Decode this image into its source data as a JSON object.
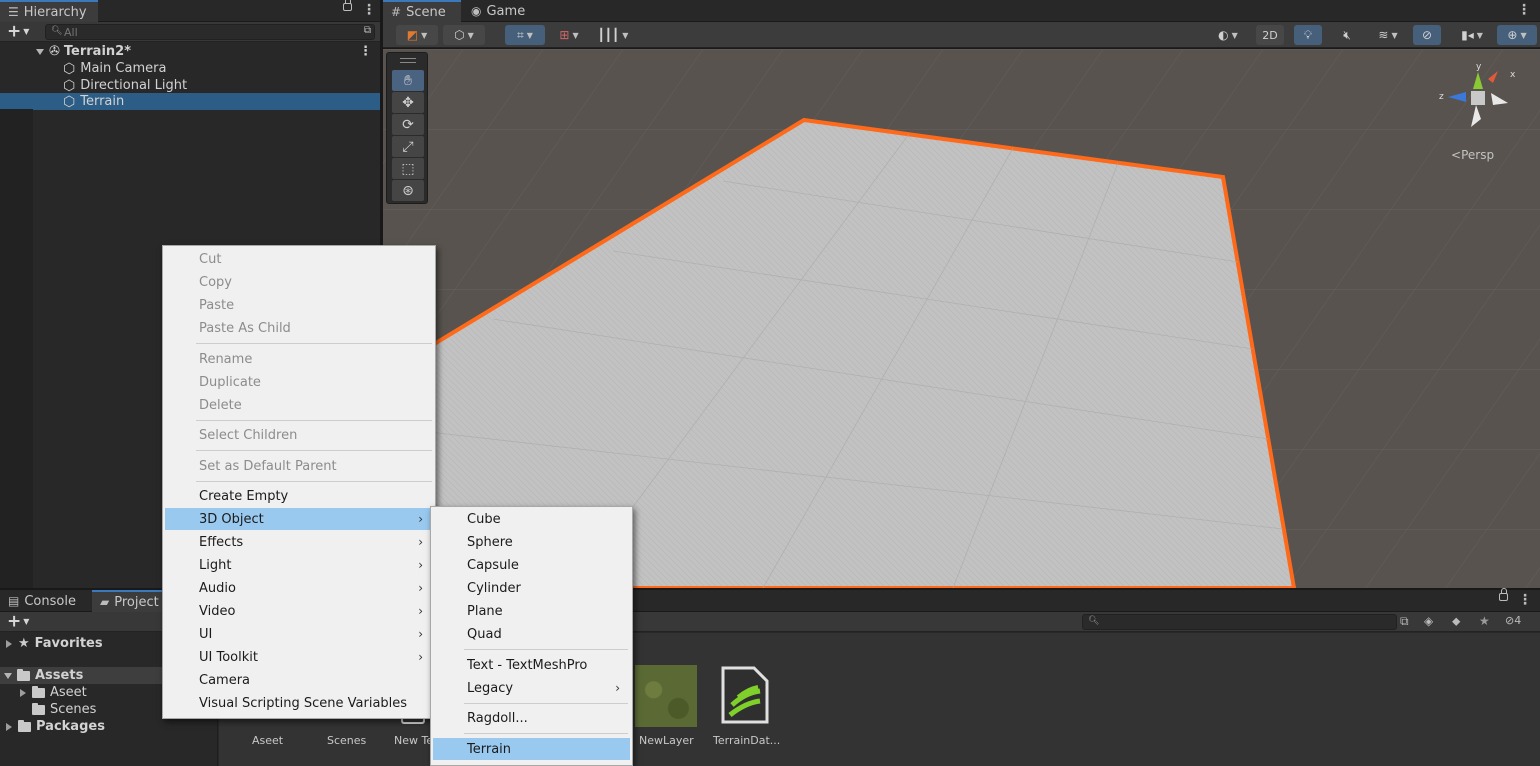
{
  "hierarchy": {
    "tab_label": "Hierarchy",
    "search_placeholder": "All",
    "scene_name": "Terrain2*",
    "items": [
      {
        "label": "Main Camera"
      },
      {
        "label": "Directional Light"
      },
      {
        "label": "Terrain",
        "selected": true
      }
    ]
  },
  "scene_view": {
    "tabs": [
      {
        "label": "Scene",
        "icon": "grid-icon",
        "active": true
      },
      {
        "label": "Game",
        "icon": "gamepad-icon",
        "active": false
      }
    ],
    "mode_2d_label": "2D",
    "persp_label": "Persp",
    "gizmo_axes": {
      "y": "y",
      "z": "z",
      "x": "x"
    },
    "terrain_outline_color": "#ff6a1a",
    "terrain_color": "#c3c3c3",
    "ground_color": "#5a5550"
  },
  "bottom_panel": {
    "tabs": [
      {
        "label": "Console",
        "active": false
      },
      {
        "label": "Project",
        "active": true
      }
    ],
    "hidden_count": "4",
    "tree": {
      "favorites": "Favorites",
      "assets": "Assets",
      "assets_children": [
        "Aseet",
        "Scenes"
      ],
      "packages": "Packages"
    },
    "assets": [
      {
        "label": "Aseet"
      },
      {
        "label": "Scenes"
      },
      {
        "label": "New Te"
      },
      {
        "label": "NewLayer"
      },
      {
        "label": "TerrainDat..."
      }
    ]
  },
  "context_menu": {
    "items": [
      {
        "label": "Cut",
        "disabled": true
      },
      {
        "label": "Copy",
        "disabled": true
      },
      {
        "label": "Paste",
        "disabled": true
      },
      {
        "label": "Paste As Child",
        "disabled": true
      },
      {
        "label": "Rename",
        "disabled": true
      },
      {
        "label": "Duplicate",
        "disabled": true
      },
      {
        "label": "Delete",
        "disabled": true
      },
      {
        "label": "Select Children",
        "disabled": true
      },
      {
        "label": "Set as Default Parent",
        "disabled": true
      },
      {
        "label": "Create Empty",
        "disabled": false
      },
      {
        "label": "3D Object",
        "disabled": false,
        "highlighted": true
      },
      {
        "label": "Effects",
        "disabled": false
      },
      {
        "label": "Light",
        "disabled": false
      },
      {
        "label": "Audio",
        "disabled": false
      },
      {
        "label": "Video",
        "disabled": false
      },
      {
        "label": "UI",
        "disabled": false
      },
      {
        "label": "UI Toolkit",
        "disabled": false
      },
      {
        "label": "Camera",
        "disabled": false
      },
      {
        "label": "Visual Scripting Scene Variables",
        "disabled": false
      }
    ],
    "submenu_arrow": "›"
  },
  "submenu_3d": {
    "items": [
      {
        "label": "Cube"
      },
      {
        "label": "Sphere"
      },
      {
        "label": "Capsule"
      },
      {
        "label": "Cylinder"
      },
      {
        "label": "Plane"
      },
      {
        "label": "Quad"
      },
      {
        "label": "Text - TextMeshPro"
      },
      {
        "label": "Legacy"
      },
      {
        "label": "Ragdoll..."
      },
      {
        "label": "Terrain",
        "highlighted": true
      }
    ]
  },
  "colors": {
    "selection": "#2c5d87",
    "menu_highlight": "#99c9ef",
    "active_tab_accent": "#3a79bb"
  }
}
